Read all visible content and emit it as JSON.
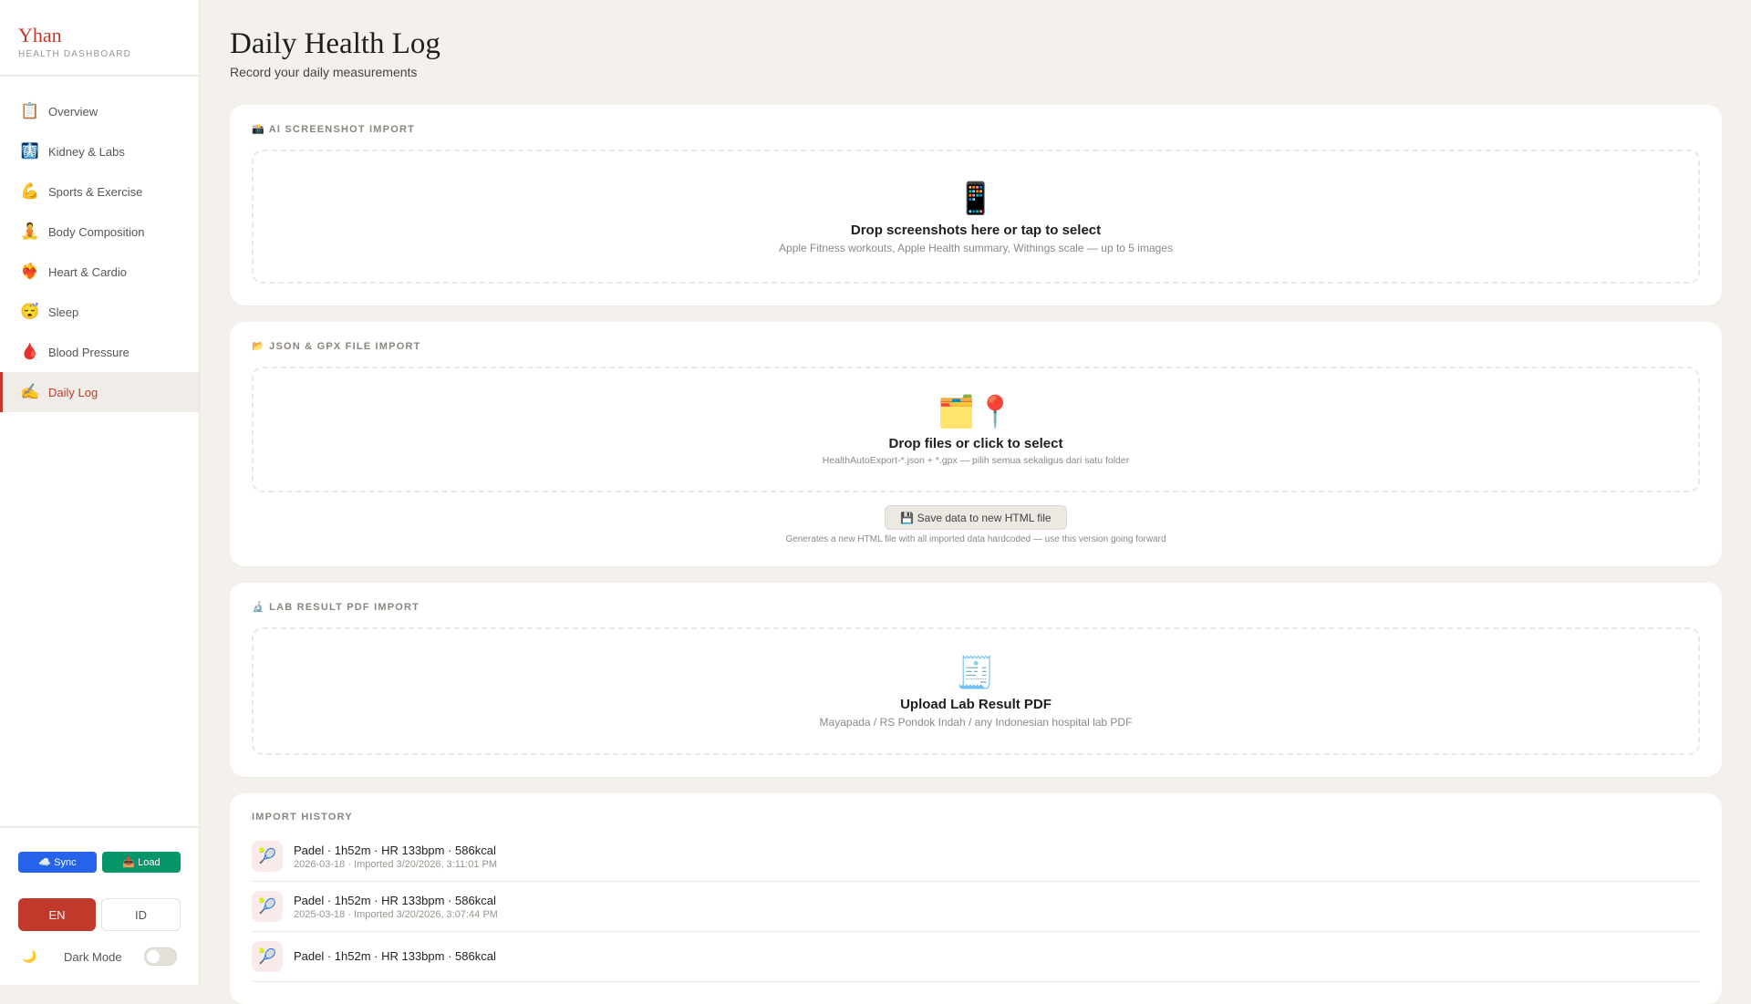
{
  "brand": {
    "name": "Yhan",
    "subtitle": "HEALTH DASHBOARD"
  },
  "nav": [
    {
      "icon": "📋",
      "label": "Overview"
    },
    {
      "icon": "🩻",
      "label": "Kidney & Labs"
    },
    {
      "icon": "💪",
      "label": "Sports & Exercise"
    },
    {
      "icon": "🧘",
      "label": "Body Composition"
    },
    {
      "icon": "❤️‍🔥",
      "label": "Heart & Cardio"
    },
    {
      "icon": "😴",
      "label": "Sleep"
    },
    {
      "icon": "🩸",
      "label": "Blood Pressure"
    },
    {
      "icon": "✍️",
      "label": "Daily Log"
    }
  ],
  "sidebar": {
    "sync": "☁️ Sync",
    "load": "📥 Load",
    "lang_en": "EN",
    "lang_id": "ID",
    "dark_icon": "🌙",
    "dark_label": "Dark Mode",
    "dark_on": false
  },
  "page": {
    "title": "Daily Health Log",
    "subtitle": "Record your daily measurements"
  },
  "screenshot_import": {
    "head": "📸 AI SCREENSHOT IMPORT",
    "icon": "📱",
    "title": "Drop screenshots here or tap to select",
    "sub": "Apple Fitness workouts, Apple Health summary, Withings scale — up to 5 images"
  },
  "file_import": {
    "head": "📂 JSON & GPX FILE IMPORT",
    "icon": "🗂️📍",
    "title": "Drop files or click to select",
    "sub": "HealthAutoExport-*.json  +  *.gpx — pilih semua sekaligus dari satu folder",
    "save": "💾 Save data to new HTML file",
    "save_note": "Generates a new HTML file with all imported data hardcoded — use this version going forward"
  },
  "lab_import": {
    "head": "🔬 LAB RESULT PDF IMPORT",
    "icon": "🧾",
    "title": "Upload Lab Result PDF",
    "sub": "Mayapada / RS Pondok Indah / any Indonesian hospital lab PDF"
  },
  "history": {
    "head": "IMPORT HISTORY",
    "items": [
      {
        "icon": "🎾",
        "title": "Padel · 1h52m · HR 133bpm · 586kcal",
        "sub": "2026-03-18 · Imported 3/20/2026, 3:11:01 PM"
      },
      {
        "icon": "🎾",
        "title": "Padel · 1h52m · HR 133bpm · 586kcal",
        "sub": "2025-03-18 · Imported 3/20/2026, 3:07:44 PM"
      },
      {
        "icon": "🎾",
        "title": "Padel · 1h52m · HR 133bpm · 586kcal",
        "sub": ""
      }
    ]
  }
}
